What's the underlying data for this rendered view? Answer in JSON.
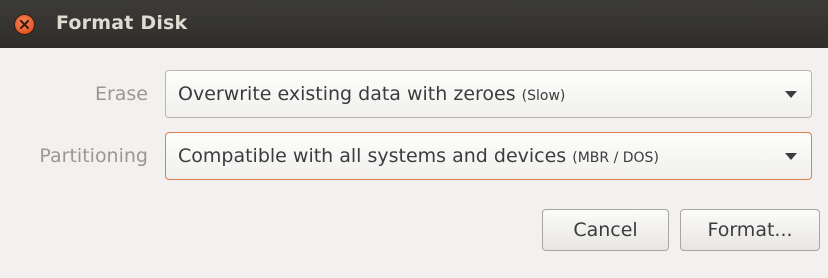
{
  "window": {
    "title": "Format Disk",
    "close_icon": "close-icon"
  },
  "erase": {
    "label": "Erase",
    "value": "Overwrite existing data with zeroes",
    "note": "(Slow)"
  },
  "partitioning": {
    "label": "Partitioning",
    "value": "Compatible with all systems and devices",
    "note": "(MBR / DOS)"
  },
  "buttons": {
    "cancel": "Cancel",
    "format": "Format..."
  },
  "colors": {
    "titlebar": "#3c3b37",
    "close_button": "#e2531e",
    "focus_border": "#e07d52"
  }
}
